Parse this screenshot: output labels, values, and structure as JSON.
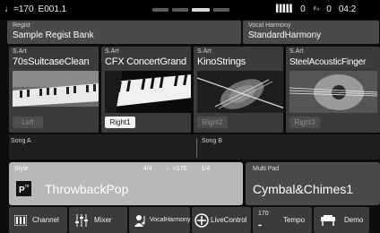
{
  "status": {
    "tempo": "♩=170",
    "song_pos": "E001.1",
    "meter_left": "∙∙∙∙",
    "meter_left_val": "0",
    "meter_right_val": "0",
    "clock": "04:2"
  },
  "regist": {
    "label": "Regist",
    "value": "Sample Regist Bank"
  },
  "vocal": {
    "label": "Vocal Harmony",
    "value": "StandardHarmony"
  },
  "voices": [
    {
      "label": "S.Art",
      "name": "70sSuitcaseClean",
      "button": "Left",
      "active": false
    },
    {
      "label": "S.Art",
      "name": "CFX ConcertGrand",
      "button": "Right1",
      "active": true
    },
    {
      "label": "S.Art",
      "name": "KinoStrings",
      "button": "Right2",
      "active": false
    },
    {
      "label": "S.Art",
      "name": "SteelAcousticFinger",
      "button": "Right3",
      "active": false
    }
  ],
  "song": {
    "a_label": "Song A",
    "b_label": "Song B"
  },
  "style": {
    "label": "Style",
    "time_sig": "4/4",
    "tempo": "♩=170",
    "beat": "1/4",
    "name": "ThrowbackPop"
  },
  "multipad": {
    "label": "Multi Pad",
    "name": "Cymbal&Chimes1"
  },
  "bottom": {
    "channel": "Channel",
    "mixer": "Mixer",
    "vocal_harmony": "VocalHarmony",
    "live_control": "LiveControl",
    "tempo_value": "170",
    "tempo": "Tempo",
    "demo": "Demo"
  },
  "colors": {
    "style_bg": "#b8b8b8",
    "panel_bg": "#4a4a4a",
    "active_button": "#f4f4f4"
  }
}
